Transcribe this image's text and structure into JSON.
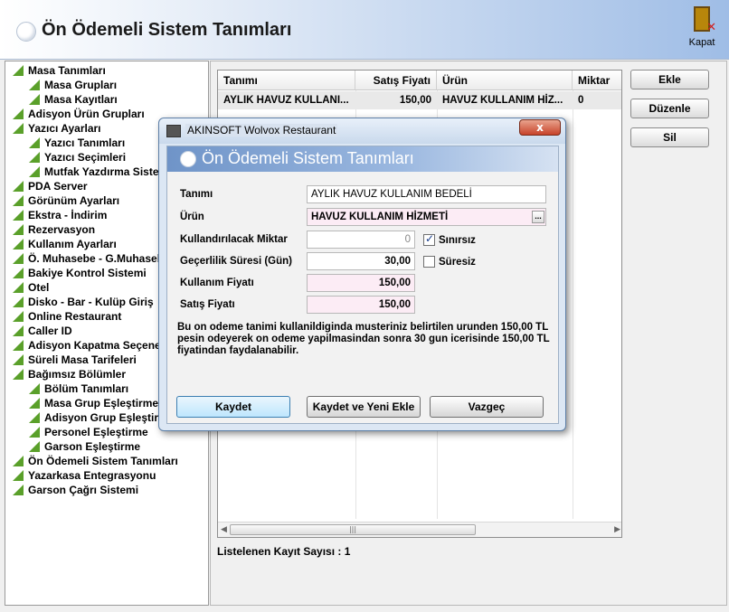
{
  "header": {
    "title": "Ön Ödemeli Sistem Tanımları",
    "close_label": "Kapat"
  },
  "tree": {
    "items": [
      {
        "label": "Masa Tanımları",
        "level": 0
      },
      {
        "label": "Masa Grupları",
        "level": 1
      },
      {
        "label": "Masa Kayıtları",
        "level": 1
      },
      {
        "label": "Adisyon Ürün Grupları",
        "level": 0
      },
      {
        "label": "Yazıcı Ayarları",
        "level": 0
      },
      {
        "label": "Yazıcı Tanımları",
        "level": 1
      },
      {
        "label": "Yazıcı Seçimleri",
        "level": 1
      },
      {
        "label": "Mutfak Yazdırma Siste",
        "level": 1
      },
      {
        "label": "PDA Server",
        "level": 0
      },
      {
        "label": "Görünüm Ayarları",
        "level": 0
      },
      {
        "label": "Ekstra - İndirim",
        "level": 0
      },
      {
        "label": "Rezervasyon",
        "level": 0
      },
      {
        "label": "Kullanım Ayarları",
        "level": 0
      },
      {
        "label": "Ö. Muhasebe - G.Muhasebe",
        "level": 0
      },
      {
        "label": "Bakiye Kontrol Sistemi",
        "level": 0
      },
      {
        "label": "Otel",
        "level": 0
      },
      {
        "label": "Disko - Bar - Kulüp Giriş",
        "level": 0
      },
      {
        "label": "Online Restaurant",
        "level": 0
      },
      {
        "label": "Caller ID",
        "level": 0
      },
      {
        "label": "Adisyon Kapatma Seçene",
        "level": 0
      },
      {
        "label": "Süreli Masa Tarifeleri",
        "level": 0
      },
      {
        "label": "Bağımsız Bölümler",
        "level": 0
      },
      {
        "label": "Bölüm Tanımları",
        "level": 1
      },
      {
        "label": "Masa Grup Eşleştirme",
        "level": 1
      },
      {
        "label": "Adisyon Grup Eşleştirm",
        "level": 1
      },
      {
        "label": "Personel Eşleştirme",
        "level": 1
      },
      {
        "label": "Garson Eşleştirme",
        "level": 1
      },
      {
        "label": "Ön Ödemeli Sistem Tanımları",
        "level": 0
      },
      {
        "label": "Yazarkasa Entegrasyonu",
        "level": 0
      },
      {
        "label": "Garson Çağrı Sistemi",
        "level": 0
      }
    ]
  },
  "grid": {
    "columns": [
      "Tanımı",
      "Satış Fiyatı",
      "Ürün",
      "Miktar"
    ],
    "rows": [
      {
        "tanimi": "AYLIK HAVUZ KULLANI...",
        "satis_fiyati": "150,00",
        "urun": "HAVUZ KULLANIM HİZ...",
        "miktar": "0"
      }
    ],
    "scroll_thumb": "|||",
    "count_label": "Listelenen Kayıt Sayısı : 1"
  },
  "buttons": {
    "add": "Ekle",
    "edit": "Düzenle",
    "delete": "Sil"
  },
  "dialog": {
    "window_title": "AKINSOFT Wolvox Restaurant",
    "close_glyph": "x",
    "header_title": "Ön Ödemeli Sistem Tanımları",
    "fields": {
      "tanimi_label": "Tanımı",
      "tanimi_value": "AYLIK HAVUZ KULLANIM BEDELİ",
      "urun_label": "Ürün",
      "urun_value": "HAVUZ KULLANIM HİZMETİ",
      "urun_button": "...",
      "miktar_label": "Kullandırılacak Miktar",
      "miktar_value": "0",
      "sinirsiz_label": "Sınırsız",
      "sinirsiz_checked": true,
      "sure_label": "Geçerlilik Süresi (Gün)",
      "sure_value": "30,00",
      "suresiz_label": "Süresiz",
      "suresiz_checked": false,
      "kullanim_fiyati_label": "Kullanım Fiyatı",
      "kullanim_fiyati_value": "150,00",
      "satis_fiyati_label": "Satış Fiyatı",
      "satis_fiyati_value": "150,00"
    },
    "info_text": "Bu on odeme tanimi kullanildiginda musteriniz belirtilen urunden 150,00 TL pesin odeyerek on odeme yapilmasindan sonra 30 gun icerisinde 150,00 TL fiyatindan faydalanabilir.",
    "buttons": {
      "save": "Kaydet",
      "save_new": "Kaydet ve Yeni Ekle",
      "cancel": "Vazgeç"
    }
  }
}
